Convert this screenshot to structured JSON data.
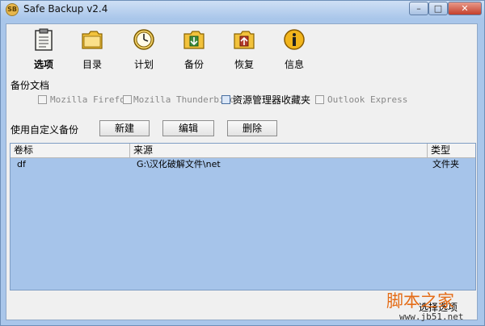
{
  "window": {
    "title": "Safe Backup v2.4"
  },
  "toolbar": {
    "items": [
      {
        "label": "选项",
        "icon": "clipboard-icon"
      },
      {
        "label": "目录",
        "icon": "folder-icon"
      },
      {
        "label": "计划",
        "icon": "clock-icon"
      },
      {
        "label": "备份",
        "icon": "backup-folder-icon"
      },
      {
        "label": "恢复",
        "icon": "restore-folder-icon"
      },
      {
        "label": "信息",
        "icon": "info-icon"
      }
    ]
  },
  "backup_docs": {
    "label": "备份文档",
    "options": [
      {
        "label": "Mozilla Firefox",
        "enabled": false,
        "checked": false
      },
      {
        "label": "Mozilla Thunderbird",
        "enabled": false,
        "checked": false
      },
      {
        "label": "资源管理器收藏夹",
        "enabled": true,
        "checked": true
      },
      {
        "label": "Outlook Express",
        "enabled": false,
        "checked": false
      }
    ]
  },
  "custom": {
    "label": "使用自定义备份",
    "new_label": "新建",
    "edit_label": "编辑",
    "delete_label": "删除"
  },
  "table": {
    "columns": [
      "卷标",
      "来源",
      "类型"
    ],
    "rows": [
      [
        "df",
        "G:\\汉化破解文件\\net",
        "文件夹"
      ]
    ]
  },
  "footer": {
    "select_label": "选择选项"
  },
  "watermark": {
    "line1": "脚本之家",
    "line2": "www.jb51.net"
  },
  "colors": {
    "accent": "#a9c6ea",
    "table_bg": "#a6c4ea",
    "watermark": "#e46c17"
  }
}
